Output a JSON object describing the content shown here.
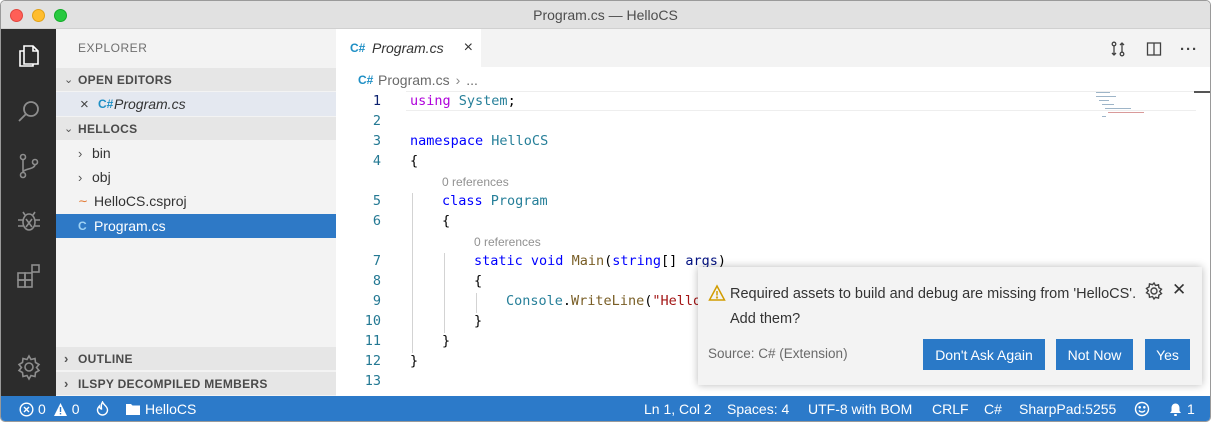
{
  "window": {
    "title": "Program.cs — HelloCS"
  },
  "activity_bar": {
    "items": [
      {
        "name": "explorer",
        "icon": "files-icon"
      },
      {
        "name": "search",
        "icon": "search-icon"
      },
      {
        "name": "source-control",
        "icon": "source-control-icon"
      },
      {
        "name": "debug",
        "icon": "debug-icon"
      },
      {
        "name": "extensions",
        "icon": "extensions-icon"
      }
    ],
    "bottom_icon": "gear-icon"
  },
  "sidebar": {
    "title": "EXPLORER",
    "open_editors": {
      "label": "OPEN EDITORS",
      "items": [
        {
          "name": "Program.cs",
          "icon": "csharp-file-icon"
        }
      ]
    },
    "folder": {
      "label": "HELLOCS",
      "items": [
        {
          "name": "bin",
          "type": "folder"
        },
        {
          "name": "obj",
          "type": "folder"
        },
        {
          "name": "HelloCS.csproj",
          "type": "file",
          "icon": "rss-icon"
        },
        {
          "name": "Program.cs",
          "type": "file",
          "icon": "csharp-file-icon",
          "selected": true
        }
      ]
    },
    "outline_label": "OUTLINE",
    "ilspy_label": "ILSPY DECOMPILED MEMBERS"
  },
  "editor": {
    "tab": {
      "label": "Program.cs",
      "close": "×"
    },
    "breadcrumb": {
      "file": "Program.cs",
      "separator": "›",
      "more": "..."
    },
    "line_numbers": [
      "1",
      "2",
      "3",
      "4",
      "5",
      "6",
      "7",
      "8",
      "9",
      "10",
      "11",
      "12",
      "13"
    ],
    "code_lens": [
      "0 references",
      "0 references"
    ],
    "code": {
      "l1_kw": "using",
      "l1_ns": "System",
      "l1_end": ";",
      "l3_kw": "namespace",
      "l3_name": "HelloCS",
      "l4": "{",
      "l5_kw": "class",
      "l5_name": "Program",
      "l6": "{",
      "l7_kw1": "static",
      "l7_kw2": "void",
      "l7_fn": "Main",
      "l7_p1": "(",
      "l7_kw3": "string",
      "l7_p2": "[] ",
      "l7_arg": "args",
      "l7_p3": ")",
      "l8": "{",
      "l9_obj": "Console",
      "l9_dot": ".",
      "l9_fn": "WriteLine",
      "l9_p": "(",
      "l9_str": "\"Hello",
      "l10": "}",
      "l11": "}",
      "l12": "}"
    }
  },
  "notification": {
    "message": "Required assets to build and debug are missing from 'HelloCS'. Add them?",
    "source": "Source: C# (Extension)",
    "buttons": [
      "Don't Ask Again",
      "Not Now",
      "Yes"
    ],
    "icon": "warning-icon"
  },
  "status_bar": {
    "errors": "0",
    "warnings": "0",
    "folder": "HelloCS",
    "position": "Ln 1, Col 2",
    "indent": "Spaces: 4",
    "encoding": "UTF-8 with BOM",
    "eol": "CRLF",
    "language": "C#",
    "sharppad": "SharpPad:5255",
    "notifications": "1"
  },
  "colors": {
    "accent": "#2c7ac9",
    "activity_bar": "#2c2c2c",
    "selected_row": "#2e79c6",
    "button": "#2a79c7"
  }
}
